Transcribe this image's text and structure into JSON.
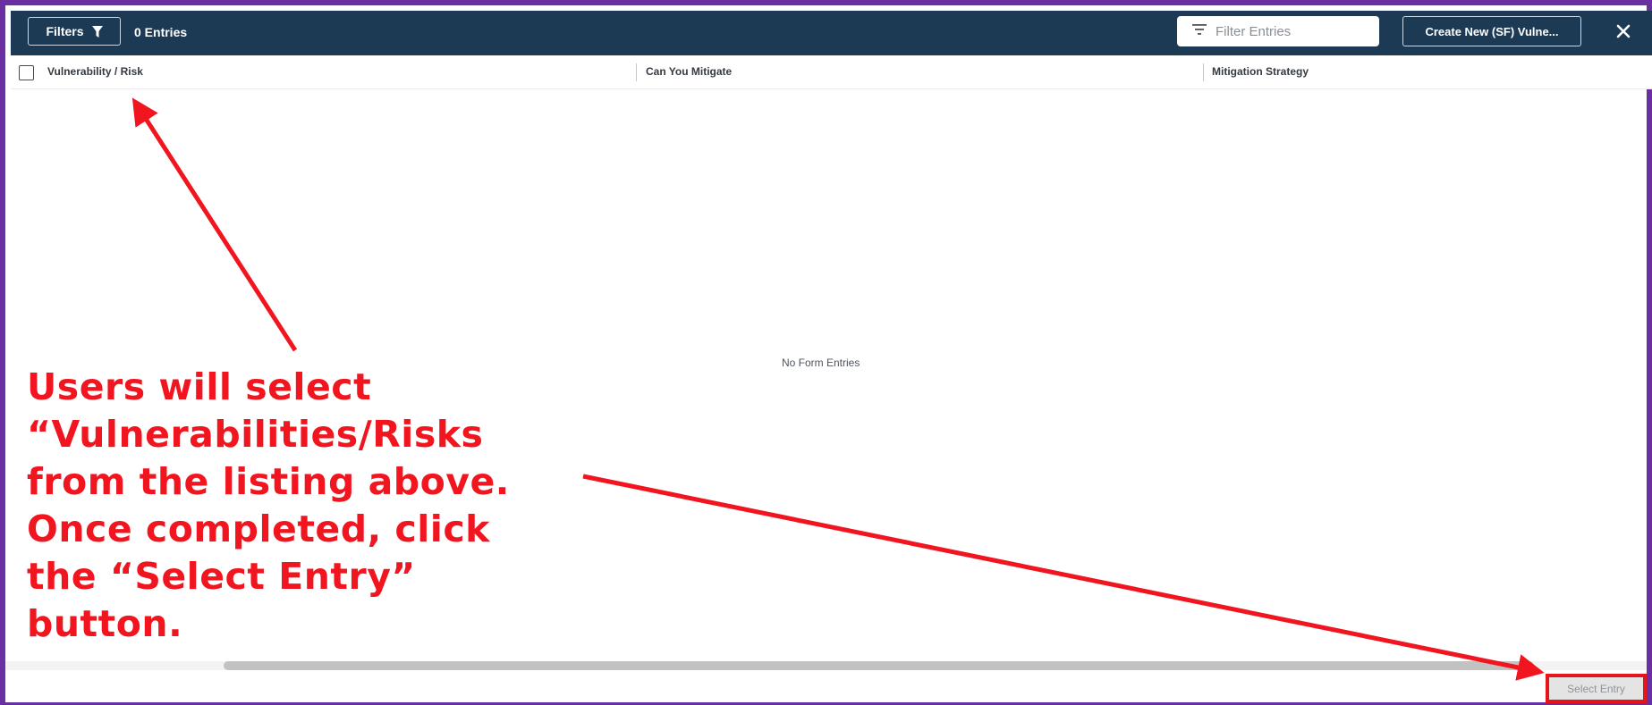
{
  "toolbar": {
    "filters_label": "Filters",
    "entries_count": "0 Entries",
    "filter_placeholder": "Filter Entries",
    "create_label": "Create New (SF) Vulne...",
    "filter_icon": "funnel-icon",
    "search_filter_icon": "filter-lines-icon",
    "close_icon": "close-icon"
  },
  "table": {
    "columns": [
      {
        "label": "Vulnerability / Risk"
      },
      {
        "label": "Can You Mitigate"
      },
      {
        "label": "Mitigation Strategy"
      }
    ],
    "empty_message": "No Form Entries"
  },
  "footer": {
    "select_entry_label": "Select Entry"
  },
  "annotation": {
    "lines": [
      "Users will select",
      "“Vulnerabilities/Risks",
      "from the listing above.",
      "Once completed, click",
      "the “Select Entry”",
      "button."
    ]
  },
  "colors": {
    "frame_border": "#6a2fa0",
    "toolbar_bg": "#1d3a55",
    "annotation_red": "#f0151f",
    "select_entry_bg": "#e4e4e4"
  }
}
